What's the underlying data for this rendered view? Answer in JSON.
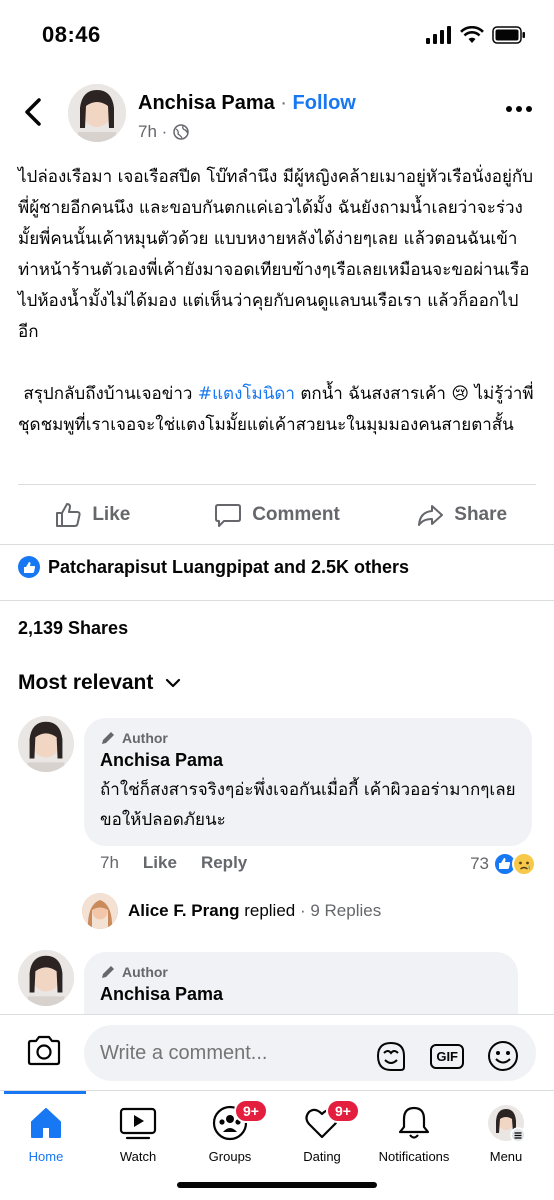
{
  "status_bar": {
    "time": "08:46"
  },
  "post": {
    "author": "Anchisa Pama",
    "separator": "·",
    "follow_label": "Follow",
    "time": "7h ·",
    "body_p1": "ไปล่องเรือมา เจอเรือสปีด โบ๊ทลำนึง มีผู้หญิงคล้ายเมาอยู่หัวเรือนั่งอยู่กับพี่ผู้ชายอีกคนนึง และขอบกันตกแค่เอวได้มั้ง ฉันยังถามน้ำเลยว่าจะร่วงมั้ยพี่คนนั้นเค้าหมุนตัวด้วย แบบหงายหลังได้ง่ายๆเลย แล้วตอนฉันเข้าท่าหน้าร้านตัวเองพี่เค้ายังมาจอดเทียบข้างๆเรือเลยเหมือนจะขอผ่านเรือไปห้องน้ำมั้งไม่ได้มอง แต่เห็นว่าคุยกับคนดูแลบนเรือเรา แล้วก็ออกไปอีก",
    "body_p2_prefix": " สรุปกลับถึงบ้านเจอข่าว ",
    "hashtag": "#แตงโมนิดา",
    "body_p2_suffix": " ตกน้ำ ฉันสงสารเค้า 😢 ไม่รู้ว่าพี่ชุดชมพูที่เราเจอจะใช่แตงโมมั้ยแต่เค้าสวยนะในมุมมองคนสายตาสั้น"
  },
  "actions": {
    "like": "Like",
    "comment": "Comment",
    "share": "Share"
  },
  "reactions_text": "Patcharapisut Luangpipat and 2.5K others",
  "shares_text": "2,139 Shares",
  "sort_label": "Most relevant",
  "comments": [
    {
      "tag": "Author",
      "name": "Anchisa Pama",
      "text": "ถ้าใช่ก็สงสารจริงๆอ่ะพึ่งเจอกันเมื่อกี้ เค้าผิวออร่ามากๆเลย ขอให้ปลอดภัยนะ",
      "time": "7h",
      "like_label": "Like",
      "reply_label": "Reply",
      "reaction_count": "73"
    },
    {
      "tag": "Author",
      "name": "Anchisa Pama"
    }
  ],
  "reply_summary": {
    "name": "Alice F. Prang",
    "verb": " replied",
    "count": " · 9 Replies"
  },
  "composer": {
    "placeholder": "Write a comment...",
    "gif": "GIF"
  },
  "tabs": [
    {
      "label": "Home",
      "badge": ""
    },
    {
      "label": "Watch",
      "badge": ""
    },
    {
      "label": "Groups",
      "badge": "9+"
    },
    {
      "label": "Dating",
      "badge": "9+"
    },
    {
      "label": "Notifications",
      "badge": ""
    },
    {
      "label": "Menu",
      "badge": ""
    }
  ],
  "colors": {
    "accent": "#1877f2",
    "badge": "#e41e3f",
    "muted": "#65676b",
    "bubble": "#f0f2f5"
  }
}
